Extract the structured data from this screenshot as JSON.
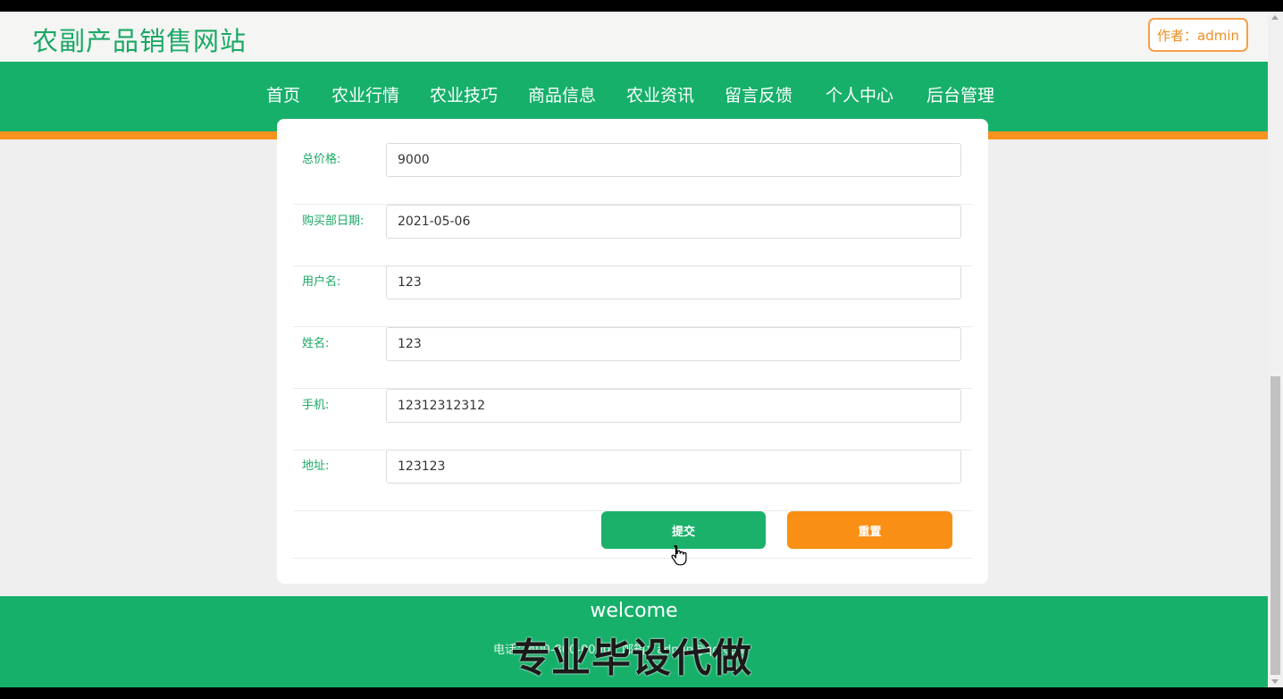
{
  "header": {
    "site_title": "农副产品销售网站",
    "author_label": "作者：admin"
  },
  "nav": {
    "items": [
      "首页",
      "农业行情",
      "农业技巧",
      "商品信息",
      "农业资讯",
      "留言反馈",
      "个人中心",
      "后台管理"
    ]
  },
  "form": {
    "fields": [
      {
        "label": "总价格:",
        "value": "9000"
      },
      {
        "label": "购买部日期:",
        "value": "2021-05-06"
      },
      {
        "label": "用户名:",
        "value": "123"
      },
      {
        "label": "姓名:",
        "value": "123"
      },
      {
        "label": "手机:",
        "value": "12312312312"
      },
      {
        "label": "地址:",
        "value": "123123"
      }
    ],
    "submit_label": "提交",
    "reset_label": "重置"
  },
  "footer": {
    "welcome": "welcome",
    "contact": "电话：400-800-0000　邮箱：admin@qq.com",
    "watermark": "专业毕设代做"
  },
  "colors": {
    "brand_green": "#16b06a",
    "accent_orange": "#f7921e"
  },
  "icons": {
    "cursor": "hand-pointer-icon"
  }
}
